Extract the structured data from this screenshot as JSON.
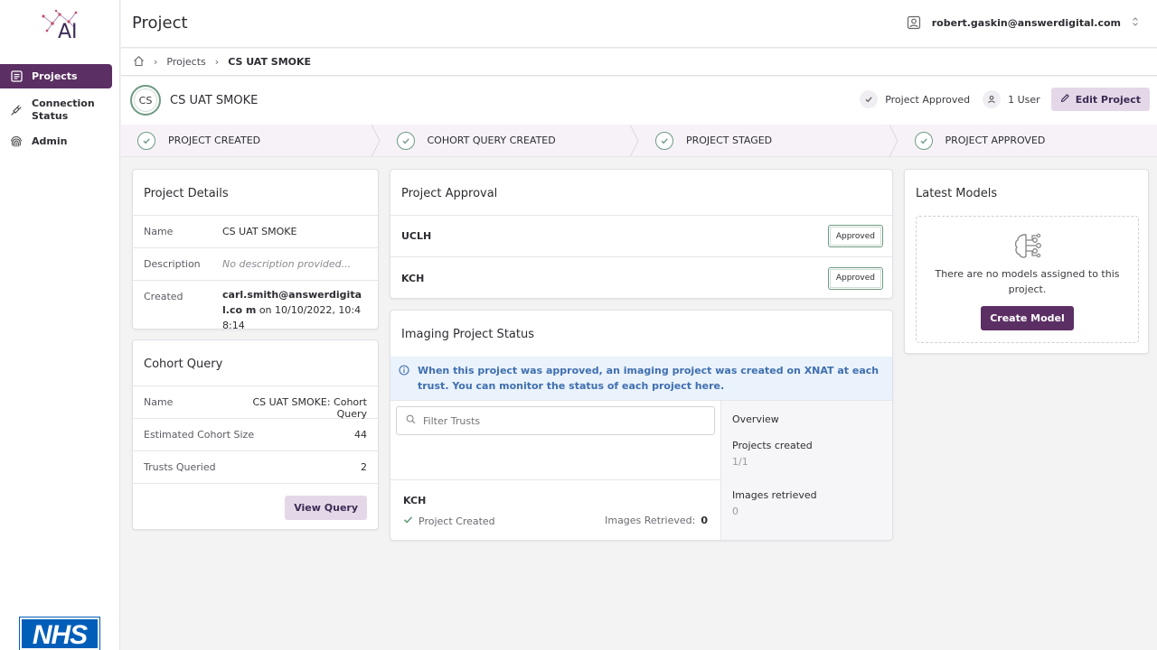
{
  "app": {
    "logo_text": "AI",
    "nhs_logo": "NHS"
  },
  "sidebar": {
    "items": [
      {
        "label": "Projects",
        "icon": "list-icon"
      },
      {
        "label": "Connection Status",
        "icon": "plug-icon"
      },
      {
        "label": "Admin",
        "icon": "fingerprint-icon"
      }
    ]
  },
  "header": {
    "title": "Project",
    "user_email": "robert.gaskin@answerdigital.com"
  },
  "breadcrumb": {
    "projects": "Projects",
    "current": "CS UAT SMOKE"
  },
  "project": {
    "initials": "CS",
    "name": "CS UAT SMOKE",
    "approved_label": "Project Approved",
    "users_label": "1 User",
    "edit_label": "Edit Project"
  },
  "steps": [
    "PROJECT CREATED",
    "COHORT QUERY CREATED",
    "PROJECT STAGED",
    "PROJECT APPROVED"
  ],
  "details": {
    "title": "Project Details",
    "name_k": "Name",
    "name_v": "CS UAT SMOKE",
    "desc_k": "Description",
    "desc_v": "No description provided...",
    "created_k": "Created",
    "created_by": "carl.smith@answerdigital.co m",
    "created_on": " on 10/10/2022, 10:48:14"
  },
  "cohort": {
    "title": "Cohort Query",
    "name_k": "Name",
    "name_v": "CS UAT SMOKE: Cohort Query",
    "size_k": "Estimated Cohort Size",
    "size_v": "44",
    "trusts_k": "Trusts Queried",
    "trusts_v": "2",
    "view_label": "View Query"
  },
  "approval": {
    "title": "Project Approval",
    "rows": [
      {
        "name": "UCLH",
        "status": "Approved"
      },
      {
        "name": "KCH",
        "status": "Approved"
      }
    ]
  },
  "imaging": {
    "title": "Imaging Project Status",
    "info": "When this project was approved, an imaging project was created on XNAT at each trust. You can monitor the status of each project here.",
    "filter_placeholder": "Filter Trusts",
    "trust_name": "KCH",
    "trust_status": "Project Created",
    "images_label": "Images Retrieved:",
    "images_value": "0",
    "overview": "Overview",
    "projects_created_label": "Projects created",
    "projects_created_value": "1/1",
    "images_retrieved_label": "Images retrieved",
    "images_retrieved_value": "0"
  },
  "models": {
    "title": "Latest Models",
    "empty_text": "There are no models assigned to this project.",
    "create_label": "Create Model"
  },
  "colors": {
    "brand": "#5b2f63",
    "brand_light": "#e4d8e8",
    "success": "#6e9a83",
    "info": "#3f6fb0",
    "nhs_blue": "#005eb8"
  }
}
